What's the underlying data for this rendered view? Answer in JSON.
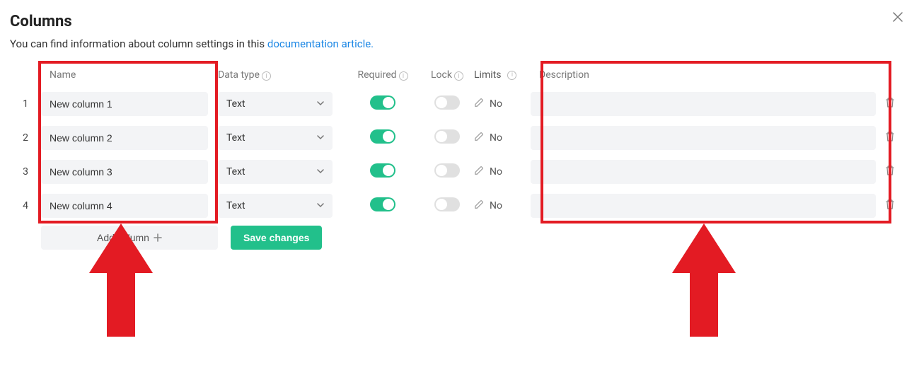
{
  "title": "Columns",
  "subtitle_prefix": "You can find information about column settings in this ",
  "subtitle_link": "documentation article.",
  "headers": {
    "name": "Name",
    "dtype": "Data type",
    "required": "Required",
    "lock": "Lock",
    "limits": "Limits",
    "description": "Description"
  },
  "rows": [
    {
      "idx": "1",
      "name": "New column 1",
      "dtype": "Text",
      "required": true,
      "lock": false,
      "limits": "No",
      "desc": ""
    },
    {
      "idx": "2",
      "name": "New column 2",
      "dtype": "Text",
      "required": true,
      "lock": false,
      "limits": "No",
      "desc": ""
    },
    {
      "idx": "3",
      "name": "New column 3",
      "dtype": "Text",
      "required": true,
      "lock": false,
      "limits": "No",
      "desc": ""
    },
    {
      "idx": "4",
      "name": "New column 4",
      "dtype": "Text",
      "required": true,
      "lock": false,
      "limits": "No",
      "desc": ""
    }
  ],
  "buttons": {
    "add_column": "Add column",
    "save": "Save changes"
  }
}
